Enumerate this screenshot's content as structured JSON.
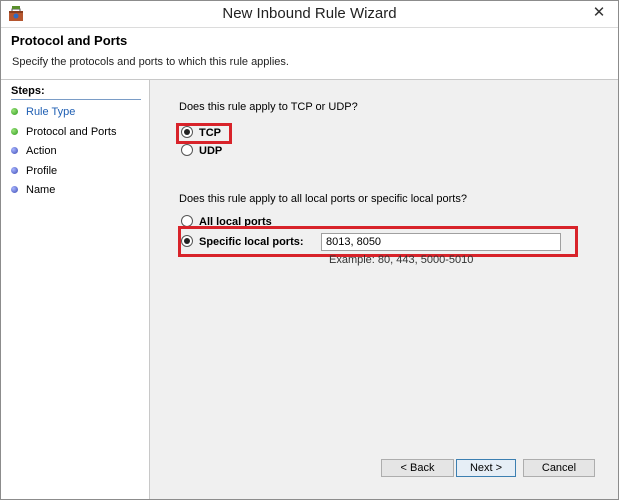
{
  "window": {
    "title": "New Inbound Rule Wizard",
    "close_glyph": "✕"
  },
  "header": {
    "title": "Protocol and Ports",
    "description": "Specify the protocols and ports to which this rule applies."
  },
  "sidebar": {
    "steps_label": "Steps:",
    "items": [
      {
        "label": "Rule Type",
        "state": "current",
        "dot": "green"
      },
      {
        "label": "Protocol and Ports",
        "state": "active",
        "dot": "green"
      },
      {
        "label": "Action",
        "state": "pending",
        "dot": "blue"
      },
      {
        "label": "Profile",
        "state": "pending",
        "dot": "blue"
      },
      {
        "label": "Name",
        "state": "pending",
        "dot": "blue"
      }
    ]
  },
  "protocol": {
    "question": "Does this rule apply to TCP or UDP?",
    "options": [
      {
        "label": "TCP",
        "checked": true
      },
      {
        "label": "UDP",
        "checked": false
      }
    ]
  },
  "ports": {
    "question": "Does this rule apply to all local ports or specific local ports?",
    "options": [
      {
        "label": "All local ports",
        "checked": false
      },
      {
        "label": "Specific local ports:",
        "checked": true
      }
    ],
    "value": "8013, 8050",
    "example": "Example: 80, 443, 5000-5010"
  },
  "buttons": {
    "back": "< Back",
    "next": "Next >",
    "cancel": "Cancel"
  },
  "colors": {
    "highlight": "#d8232a",
    "link_blue": "#1f5fb3"
  }
}
